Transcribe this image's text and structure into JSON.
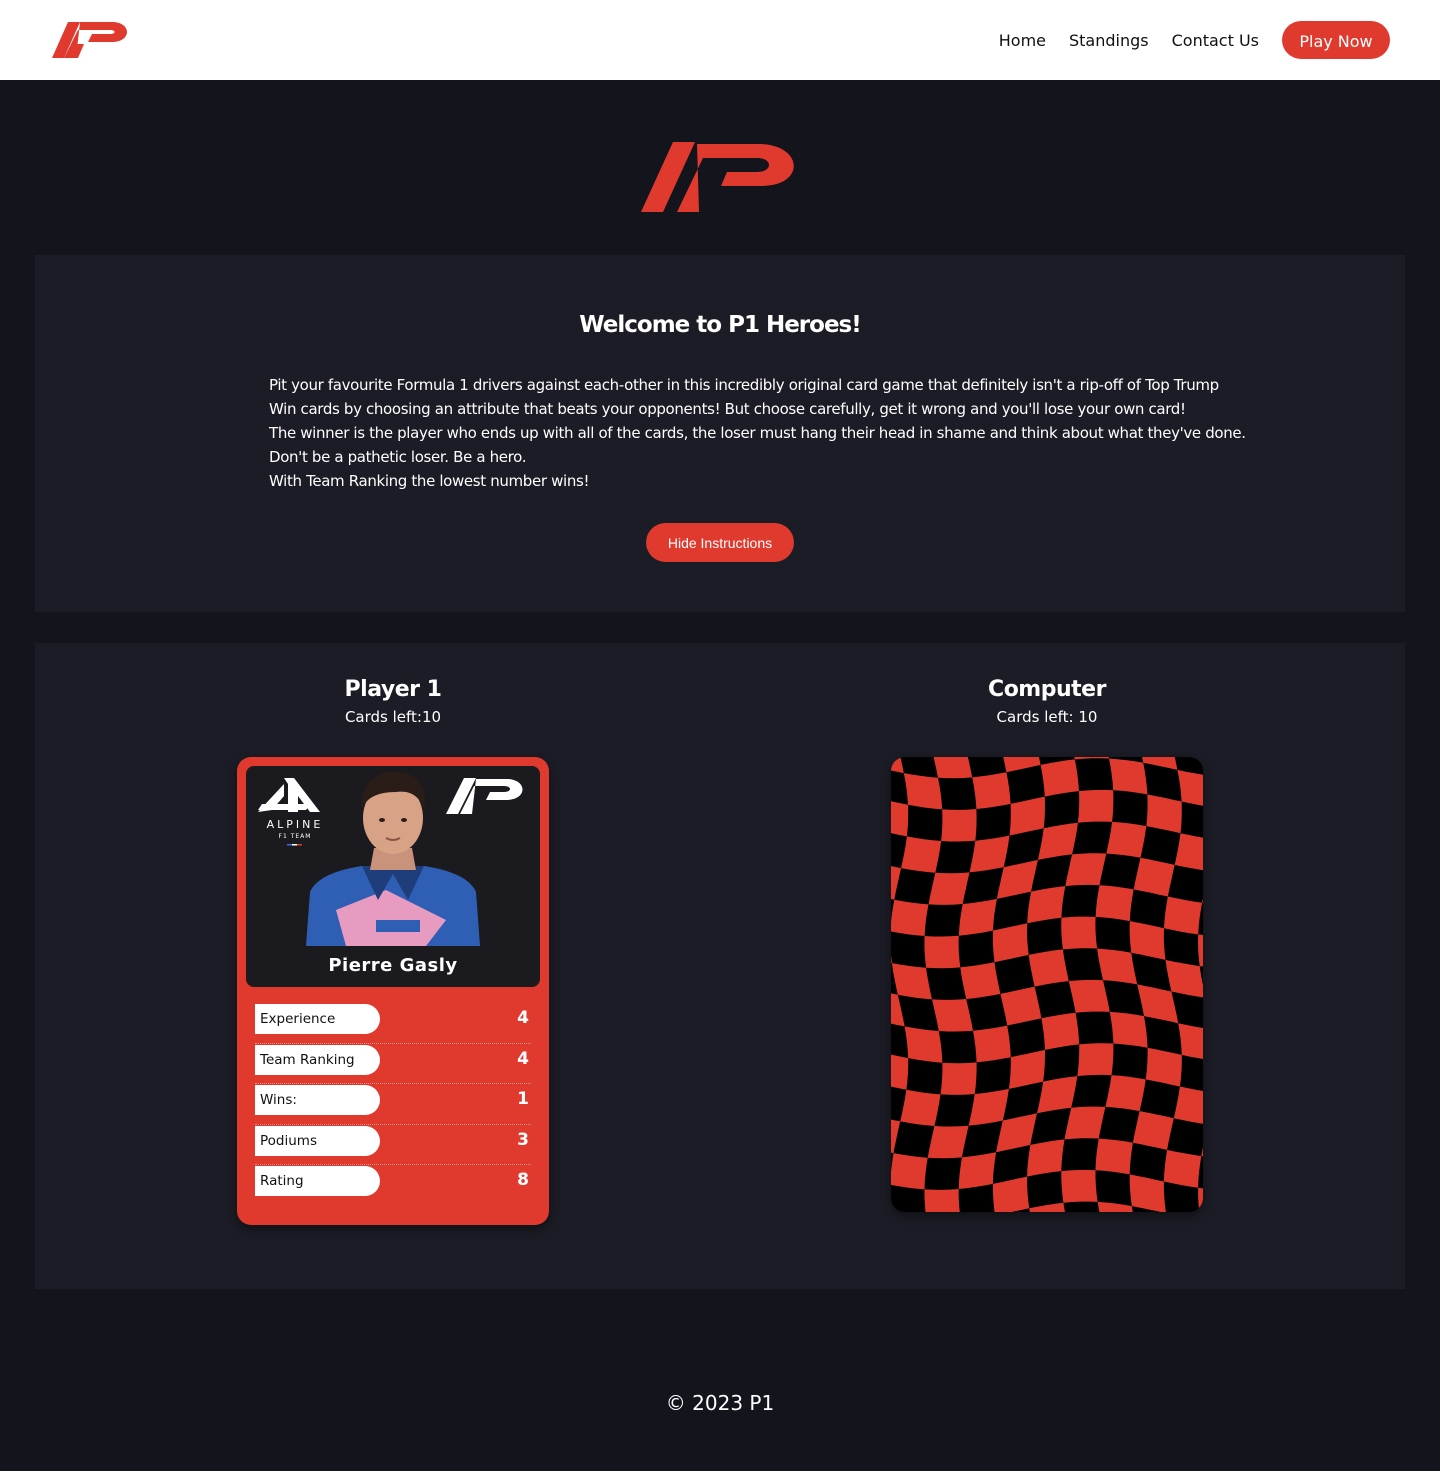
{
  "colors": {
    "accent": "#e03a2f",
    "background": "#14141c",
    "panel": "#1c1c26"
  },
  "header": {
    "logo_icon": "p1-logo-icon",
    "nav": [
      {
        "label": "Home"
      },
      {
        "label": "Standings"
      },
      {
        "label": "Contact Us"
      }
    ],
    "cta_label": "Play Now"
  },
  "instructions": {
    "title": "Welcome to P1 Heroes!",
    "lines": [
      "Pit your favourite Formula 1 drivers against each-other in this incredibly original card game that definitely isn't a rip-off of Top Trump",
      "Win cards by choosing an attribute that beats your opponents! But choose carefully, get it wrong and you'll lose your own card!",
      "The winner is the player who ends up with all of the cards, the loser must hang their head in shame and think about what they've done.",
      "Don't be a pathetic loser. Be a hero.",
      "With Team Ranking the lowest number wins!"
    ],
    "hide_button": "Hide Instructions"
  },
  "game": {
    "player": {
      "name": "Player 1",
      "cards_left": "Cards left:10",
      "card": {
        "team_logo_text": "ALPINE",
        "team_logo_subtext": "F1 TEAM",
        "driver": "Pierre Gasly",
        "stats": [
          {
            "label": "Experience",
            "value": "4"
          },
          {
            "label": "Team Ranking",
            "value": "4"
          },
          {
            "label": "Wins:",
            "value": "1"
          },
          {
            "label": "Podiums",
            "value": "3"
          },
          {
            "label": "Rating",
            "value": "8"
          }
        ]
      }
    },
    "computer": {
      "name": "Computer",
      "cards_left": "Cards left: 10",
      "card_back_icon": "checkered-flag-pattern"
    }
  },
  "footer": {
    "text": "© 2023 P1"
  }
}
